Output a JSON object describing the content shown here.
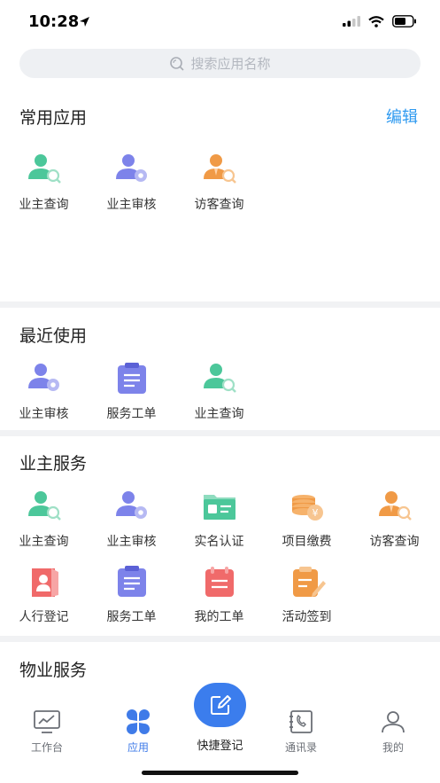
{
  "status_bar": {
    "time": "10:28"
  },
  "search": {
    "placeholder": "搜索应用名称"
  },
  "sections": {
    "common": {
      "title": "常用应用",
      "edit_label": "编辑",
      "items": [
        {
          "label": "业主查询",
          "icon": "owner-search-icon"
        },
        {
          "label": "业主审核",
          "icon": "owner-review-icon"
        },
        {
          "label": "访客查询",
          "icon": "visitor-search-icon"
        }
      ]
    },
    "recent": {
      "title": "最近使用",
      "items": [
        {
          "label": "业主审核",
          "icon": "owner-review-icon"
        },
        {
          "label": "服务工单",
          "icon": "service-order-icon"
        },
        {
          "label": "业主查询",
          "icon": "owner-search-icon"
        }
      ]
    },
    "owner_service": {
      "title": "业主服务",
      "items": [
        {
          "label": "业主查询",
          "icon": "owner-search-icon"
        },
        {
          "label": "业主审核",
          "icon": "owner-review-icon"
        },
        {
          "label": "实名认证",
          "icon": "id-card-icon"
        },
        {
          "label": "项目缴费",
          "icon": "payment-coins-icon"
        },
        {
          "label": "访客查询",
          "icon": "visitor-search-icon"
        },
        {
          "label": "人行登记",
          "icon": "pedestrian-register-icon"
        },
        {
          "label": "服务工单",
          "icon": "service-order-icon"
        },
        {
          "label": "我的工单",
          "icon": "my-order-icon"
        },
        {
          "label": "活动签到",
          "icon": "activity-checkin-icon"
        }
      ]
    },
    "property_service": {
      "title": "物业服务"
    }
  },
  "tab_bar": {
    "workbench": "工作台",
    "apps": "应用",
    "quick_register": "快捷登记",
    "contacts": "通讯录",
    "mine": "我的"
  },
  "colors": {
    "accent": "#3b7ded",
    "link": "#2f9af0",
    "green": "#4cc79a",
    "purple": "#7d83ea",
    "orange": "#f09a46",
    "red": "#f06a6a"
  }
}
